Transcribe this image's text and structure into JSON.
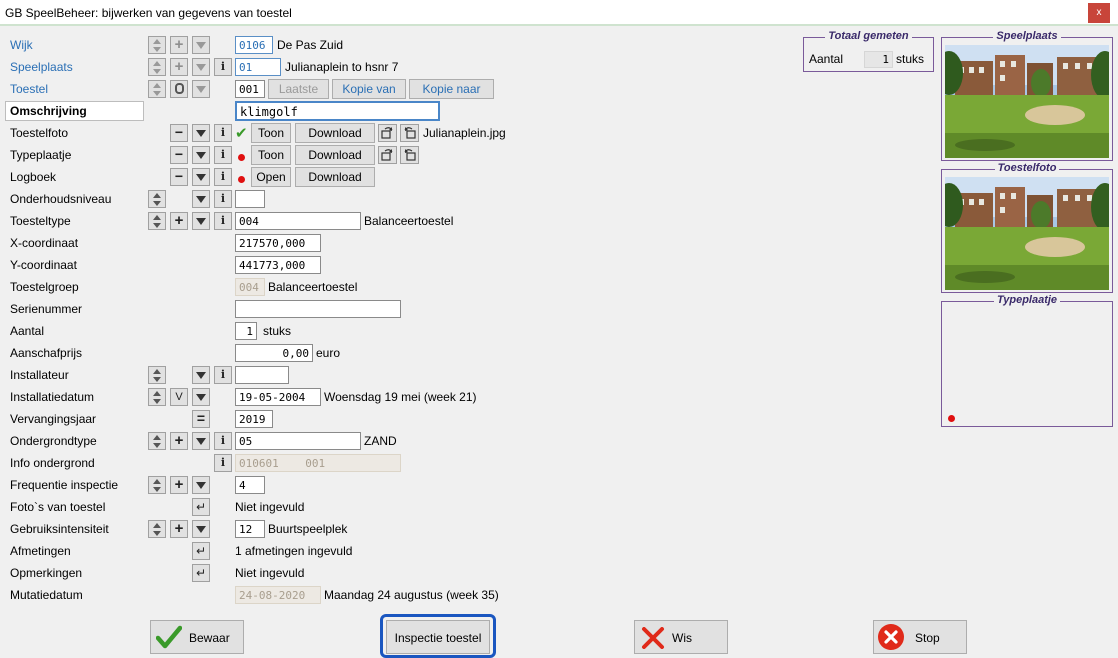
{
  "window": {
    "title": "GB SpeelBeheer: bijwerken van gegevens van toestel",
    "close_label": "x"
  },
  "form": {
    "wijk": {
      "label": "Wijk",
      "code": "0106",
      "name": "De Pas Zuid"
    },
    "speelplaats": {
      "label": "Speelplaats",
      "code": "01",
      "name": "Julianaplein to hsnr 7"
    },
    "toestel": {
      "label": "Toestel",
      "code": "001",
      "btn_laatste": "Laatste",
      "btn_kopie_van": "Kopie van",
      "btn_kopie_naar": "Kopie naar"
    },
    "omschrijving": {
      "label": "Omschrijving",
      "value": "klimgolf"
    },
    "toestelfoto": {
      "label": "Toestelfoto",
      "btn_toon": "Toon",
      "btn_download": "Download",
      "filename": "Julianaplein.jpg"
    },
    "typeplaatje": {
      "label": "Typeplaatje",
      "btn_toon": "Toon",
      "btn_download": "Download"
    },
    "logboek": {
      "label": "Logboek",
      "btn_open": "Open",
      "btn_download": "Download"
    },
    "onderhoudsniveau": {
      "label": "Onderhoudsniveau",
      "value": ""
    },
    "toesteltype": {
      "label": "Toesteltype",
      "value": "004",
      "desc": "Balanceertoestel"
    },
    "x_coordinaat": {
      "label": "X-coordinaat",
      "value": "217570,000"
    },
    "y_coordinaat": {
      "label": "Y-coordinaat",
      "value": "441773,000"
    },
    "toestelgroep": {
      "label": "Toestelgroep",
      "value": "004",
      "desc": "Balanceertoestel"
    },
    "serienummer": {
      "label": "Serienummer",
      "value": ""
    },
    "aantal": {
      "label": "Aantal",
      "value": "1",
      "unit": "stuks"
    },
    "aanschafprijs": {
      "label": "Aanschafprijs",
      "value": "0,00",
      "unit": "euro"
    },
    "installateur": {
      "label": "Installateur",
      "value": ""
    },
    "installatiedatum": {
      "label": "Installatiedatum",
      "btn_v": "V",
      "value": "19-05-2004",
      "desc": "Woensdag 19 mei (week 21)"
    },
    "vervangingsjaar": {
      "label": "Vervangingsjaar",
      "value": "2019"
    },
    "ondergrondtype": {
      "label": "Ondergrondtype",
      "value": "05",
      "desc": "ZAND"
    },
    "info_ondergrond": {
      "label": "Info ondergrond",
      "value": "010601    001"
    },
    "frequentie_inspectie": {
      "label": "Frequentie inspectie",
      "value": "4"
    },
    "fotos_van_toestel": {
      "label": "Foto`s van toestel",
      "desc": "Niet ingevuld"
    },
    "gebruiksintensiteit": {
      "label": "Gebruiksintensiteit",
      "value": "12",
      "desc": "Buurtspeelplek"
    },
    "afmetingen": {
      "label": "Afmetingen",
      "desc": "1 afmetingen ingevuld"
    },
    "opmerkingen": {
      "label": "Opmerkingen",
      "desc": "Niet ingevuld"
    },
    "mutatiedatum": {
      "label": "Mutatiedatum",
      "value": "24-08-2020",
      "desc": "Maandag 24 augustus (week 35)"
    }
  },
  "totaal": {
    "title": "Totaal gemeten",
    "label": "Aantal",
    "value": "1",
    "unit": "stuks"
  },
  "panels": {
    "speelplaats": "Speelplaats",
    "toestelfoto": "Toestelfoto",
    "typeplaatje": "Typeplaatje"
  },
  "buttons": {
    "bewaar": "Bewaar",
    "inspectie": "Inspectie toestel",
    "wis": "Wis",
    "stop": "Stop"
  },
  "colors": {
    "accent_blue": "#2a6fb5",
    "focus_blue": "#1a56c0",
    "check_green": "#3a9a2a",
    "error_red": "#e01010",
    "group_border": "#7a5a9a"
  }
}
